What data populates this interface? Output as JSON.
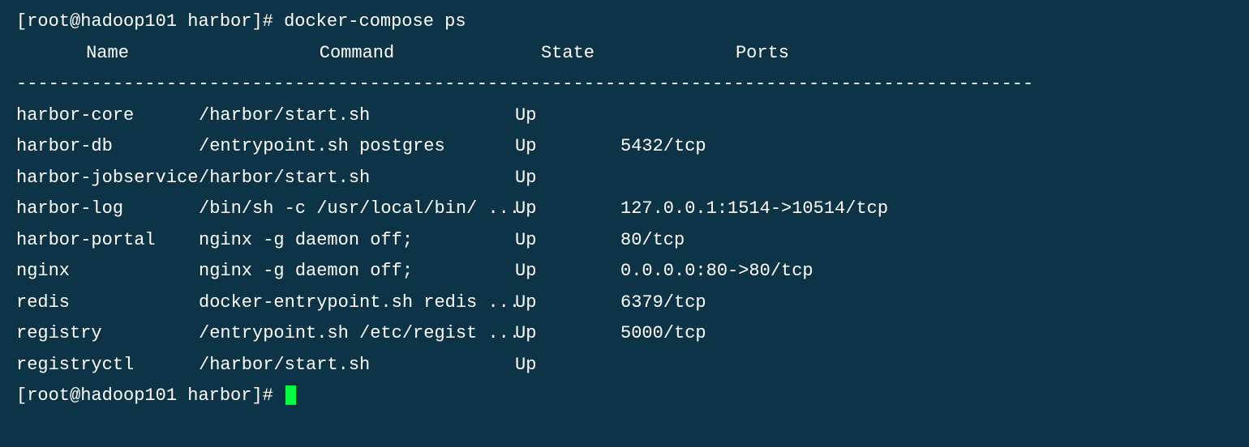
{
  "prompt": {
    "user": "root",
    "host": "hadoop101",
    "dir": "harbor",
    "command": "docker-compose ps"
  },
  "headers": {
    "name": "Name",
    "command": "Command",
    "state": "State",
    "ports": "Ports"
  },
  "divider": "-----------------------------------------------------------------------------------------------",
  "rows": [
    {
      "name": "harbor-core",
      "command": "/harbor/start.sh",
      "state": "Up",
      "ports": ""
    },
    {
      "name": "harbor-db",
      "command": "/entrypoint.sh postgres",
      "state": "Up",
      "ports": "5432/tcp"
    },
    {
      "name": "harbor-jobservice",
      "command": "/harbor/start.sh",
      "state": "Up",
      "ports": ""
    },
    {
      "name": "harbor-log",
      "command": "/bin/sh -c /usr/local/bin/ ...",
      "state": "Up",
      "ports": "127.0.0.1:1514->10514/tcp"
    },
    {
      "name": "harbor-portal",
      "command": "nginx -g daemon off;",
      "state": "Up",
      "ports": "80/tcp"
    },
    {
      "name": "nginx",
      "command": "nginx -g daemon off;",
      "state": "Up",
      "ports": "0.0.0.0:80->80/tcp"
    },
    {
      "name": "redis",
      "command": "docker-entrypoint.sh redis ...",
      "state": "Up",
      "ports": "6379/tcp"
    },
    {
      "name": "registry",
      "command": "/entrypoint.sh /etc/regist ...",
      "state": "Up",
      "ports": "5000/tcp"
    },
    {
      "name": "registryctl",
      "command": "/harbor/start.sh",
      "state": "Up",
      "ports": ""
    }
  ]
}
